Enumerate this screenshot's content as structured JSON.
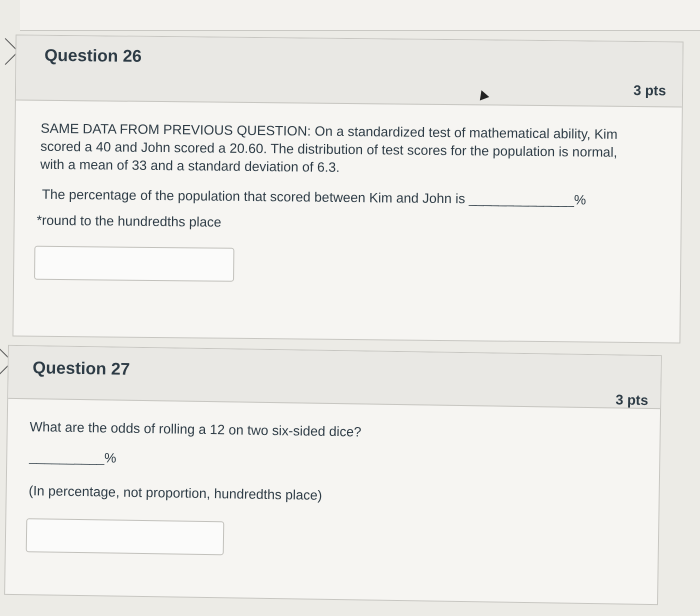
{
  "q26": {
    "title": "Question 26",
    "points": "3 pts",
    "text_line1": "SAME DATA FROM PREVIOUS QUESTION: On a standardized test of mathematical ability, Kim",
    "text_line2": "scored a 40 and John scored a 20.60. The distribution of test scores for the population is normal,",
    "text_line3": "with a mean of 33 and a standard deviation of 6.3.",
    "prompt": "The percentage of the population that scored between Kim and John is ______________%",
    "note": "*round to the hundredths place",
    "answer_value": ""
  },
  "q27": {
    "title": "Question 27",
    "points": "3 pts",
    "text": "What are the odds of rolling a 12 on two six-sided dice?",
    "blank": "__________%",
    "note": "(In percentage, not proportion, hundredths place)",
    "answer_value": ""
  }
}
